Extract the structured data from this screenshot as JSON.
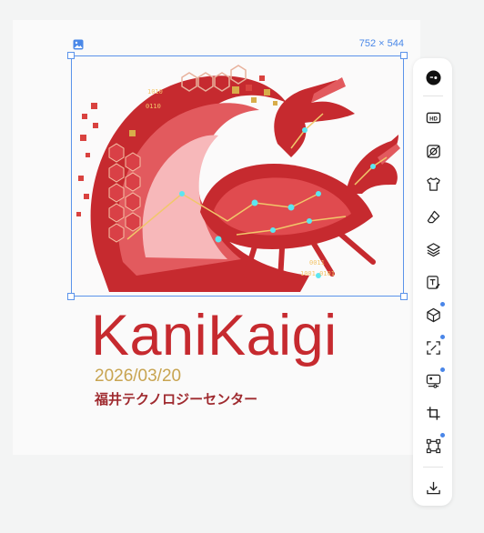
{
  "canvas": {
    "image_dimensions": "752 × 544",
    "icon": "image-icon"
  },
  "artwork": {
    "title": "KaniKaigi",
    "date": "2026/03/20",
    "venue": "福井テクノロジーセンター",
    "illustration": "crab-and-wave-logo"
  },
  "toolbar": {
    "tools": [
      {
        "name": "ai-assistant-icon",
        "dot": false
      },
      {
        "name": "hd-icon",
        "label": "HD",
        "dot": false
      },
      {
        "name": "remove-background-icon",
        "dot": false
      },
      {
        "name": "tshirt-icon",
        "dot": false
      },
      {
        "name": "eraser-icon",
        "dot": false
      },
      {
        "name": "layers-icon",
        "dot": false
      },
      {
        "name": "edit-text-icon",
        "dot": false
      },
      {
        "name": "3d-cube-icon",
        "dot": true
      },
      {
        "name": "expand-icon",
        "dot": true
      },
      {
        "name": "image-adjust-icon",
        "dot": true
      },
      {
        "name": "crop-icon",
        "dot": false
      },
      {
        "name": "transform-icon",
        "dot": true
      },
      {
        "name": "download-icon",
        "dot": false
      }
    ]
  },
  "colors": {
    "selection": "#5b93ea",
    "title": "#c62a2f",
    "date": "#c8a451",
    "venue": "#9f2a2f",
    "badge_dot": "#4a86e8"
  }
}
